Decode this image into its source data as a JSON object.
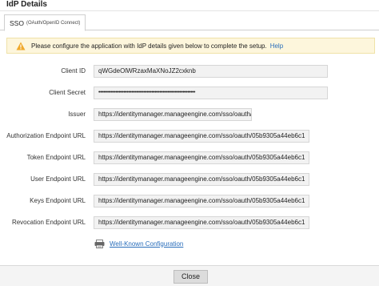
{
  "dialog": {
    "title": "IdP Details"
  },
  "tabs": [
    {
      "label": "SSO",
      "sublabel": "(OAuth/OpenID Connect)"
    }
  ],
  "alert": {
    "message": "Please configure the application with IdP details given below to complete the setup.",
    "help_link": "Help",
    "icon": "warning-icon",
    "background": "#fdf6dc"
  },
  "fields": [
    {
      "label": "Client ID",
      "value": "qWGdeOlWRzaxMaXNoJZ2cxknb"
    },
    {
      "label": "Client Secret",
      "value": "••••••••••••••••••••••••••••••••••••••••••••••••••••••••••••••"
    },
    {
      "label": "Issuer",
      "value": "https://identitymanager.manageengine.com/sso/oauth/"
    },
    {
      "label": "Authorization Endpoint URL",
      "value": "https://identitymanager.manageengine.com/sso/oauth/05b9305a44eb6c1"
    },
    {
      "label": "Token Endpoint URL",
      "value": "https://identitymanager.manageengine.com/sso/oauth/05b9305a44eb6c1"
    },
    {
      "label": "User Endpoint URL",
      "value": "https://identitymanager.manageengine.com/sso/oauth/05b9305a44eb6c1"
    },
    {
      "label": "Keys Endpoint URL",
      "value": "https://identitymanager.manageengine.com/sso/oauth/05b9305a44eb6c1"
    },
    {
      "label": "Revocation Endpoint URL",
      "value": "https://identitymanager.manageengine.com/sso/oauth/05b9305a44eb6c1"
    }
  ],
  "wellknown": {
    "label": "Well-Known Configuration",
    "icon": "config-icon"
  },
  "footer": {
    "close_label": "Close"
  },
  "colors": {
    "link": "#2a6ebb",
    "field_bg": "#f2f2f2"
  }
}
